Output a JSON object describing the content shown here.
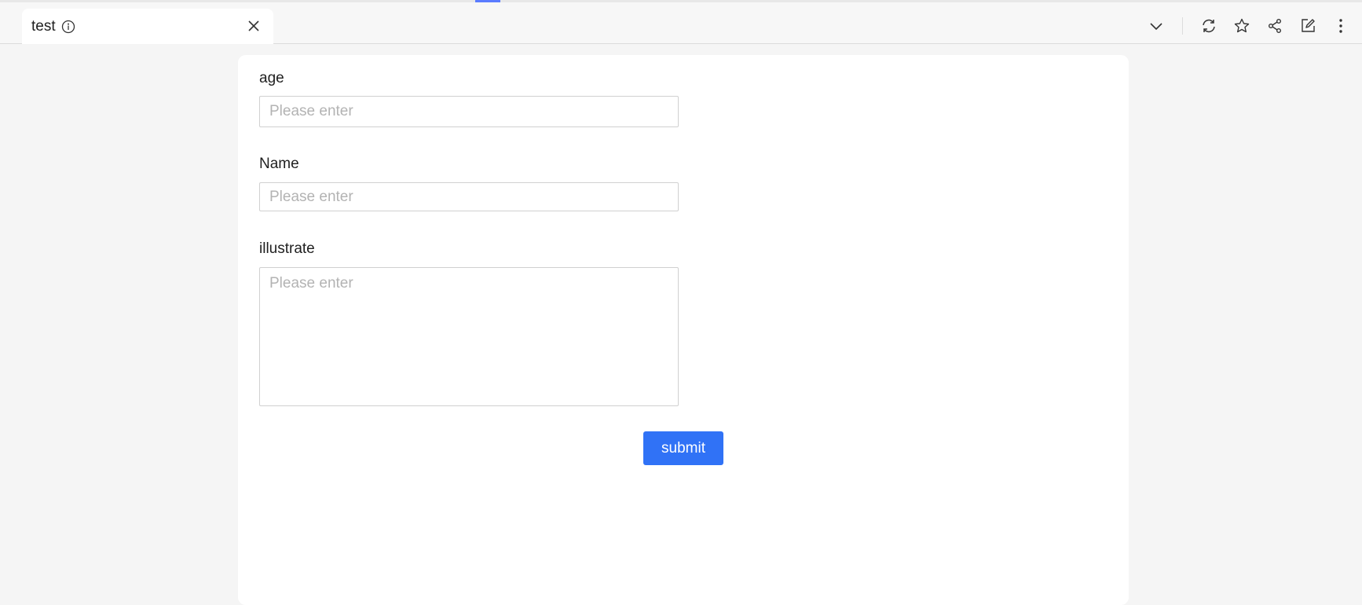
{
  "tab": {
    "title": "test",
    "info_icon": "info-icon",
    "close_icon": "close-icon"
  },
  "toolbar": {
    "icons": [
      "chevron-down-icon",
      "refresh-icon",
      "star-icon",
      "share-icon",
      "edit-icon",
      "more-vertical-icon"
    ]
  },
  "form": {
    "age": {
      "label": "age",
      "placeholder": "Please enter"
    },
    "name": {
      "label": "Name",
      "placeholder": "Please enter"
    },
    "illustrate": {
      "label": "illustrate",
      "placeholder": "Please enter"
    },
    "submit_label": "submit"
  },
  "colors": {
    "accent": "#3072f6",
    "tab_bar_bg": "#f7f7f7",
    "page_bg": "#f5f5f5"
  }
}
